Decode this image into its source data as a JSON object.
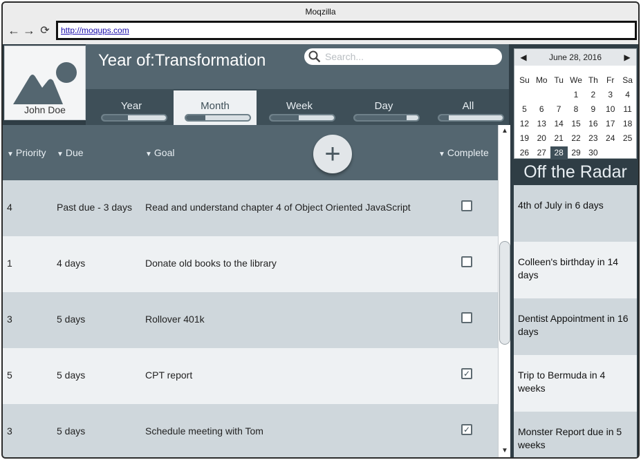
{
  "window": {
    "title": "Moqzilla",
    "url": "http://moqups.com"
  },
  "profile": {
    "name": "John Doe"
  },
  "header": {
    "title": "Year of:Transformation"
  },
  "search": {
    "placeholder": "Search..."
  },
  "tabs": [
    {
      "label": "Year",
      "progress": 0.4
    },
    {
      "label": "Month",
      "progress": 0.3,
      "active": true
    },
    {
      "label": "Week",
      "progress": 0.45
    },
    {
      "label": "Day",
      "progress": 0.82
    },
    {
      "label": "All",
      "progress": 0.15
    }
  ],
  "table": {
    "headers": {
      "priority": "Priority",
      "due": "Due",
      "goal": "Goal",
      "complete": "Complete"
    },
    "rows": [
      {
        "priority": "4",
        "due": "Past due - 3 days",
        "goal": "Read and understand chapter 4 of Object Oriented JavaScript",
        "complete": false
      },
      {
        "priority": "1",
        "due": "4 days",
        "goal": "Donate old books to the library",
        "complete": false
      },
      {
        "priority": "3",
        "due": "5 days",
        "goal": "Rollover 401k",
        "complete": false
      },
      {
        "priority": "5",
        "due": "5 days",
        "goal": "CPT report",
        "complete": true
      },
      {
        "priority": "3",
        "due": "5 days",
        "goal": "Schedule meeting with Tom",
        "complete": true
      }
    ]
  },
  "calendar": {
    "month_label": "June 28, 2016",
    "weekdays": [
      "Su",
      "Mo",
      "Tu",
      "We",
      "Th",
      "Fr",
      "Sa"
    ],
    "leading_blanks": 3,
    "days": 30,
    "selected": 28
  },
  "radar": {
    "title": "Off the Radar",
    "items": [
      "4th of July in 6 days",
      "Colleen's birthday in 14 days",
      "Dentist Appointment in 16 days",
      "Trip to Bermuda in 4 weeks",
      "Monster Report due in 5 weeks"
    ]
  },
  "colors": {
    "header": "#546670",
    "tabs": "#3e4f58",
    "row_odd": "#cfd7dc",
    "row_even": "#eef1f3"
  }
}
